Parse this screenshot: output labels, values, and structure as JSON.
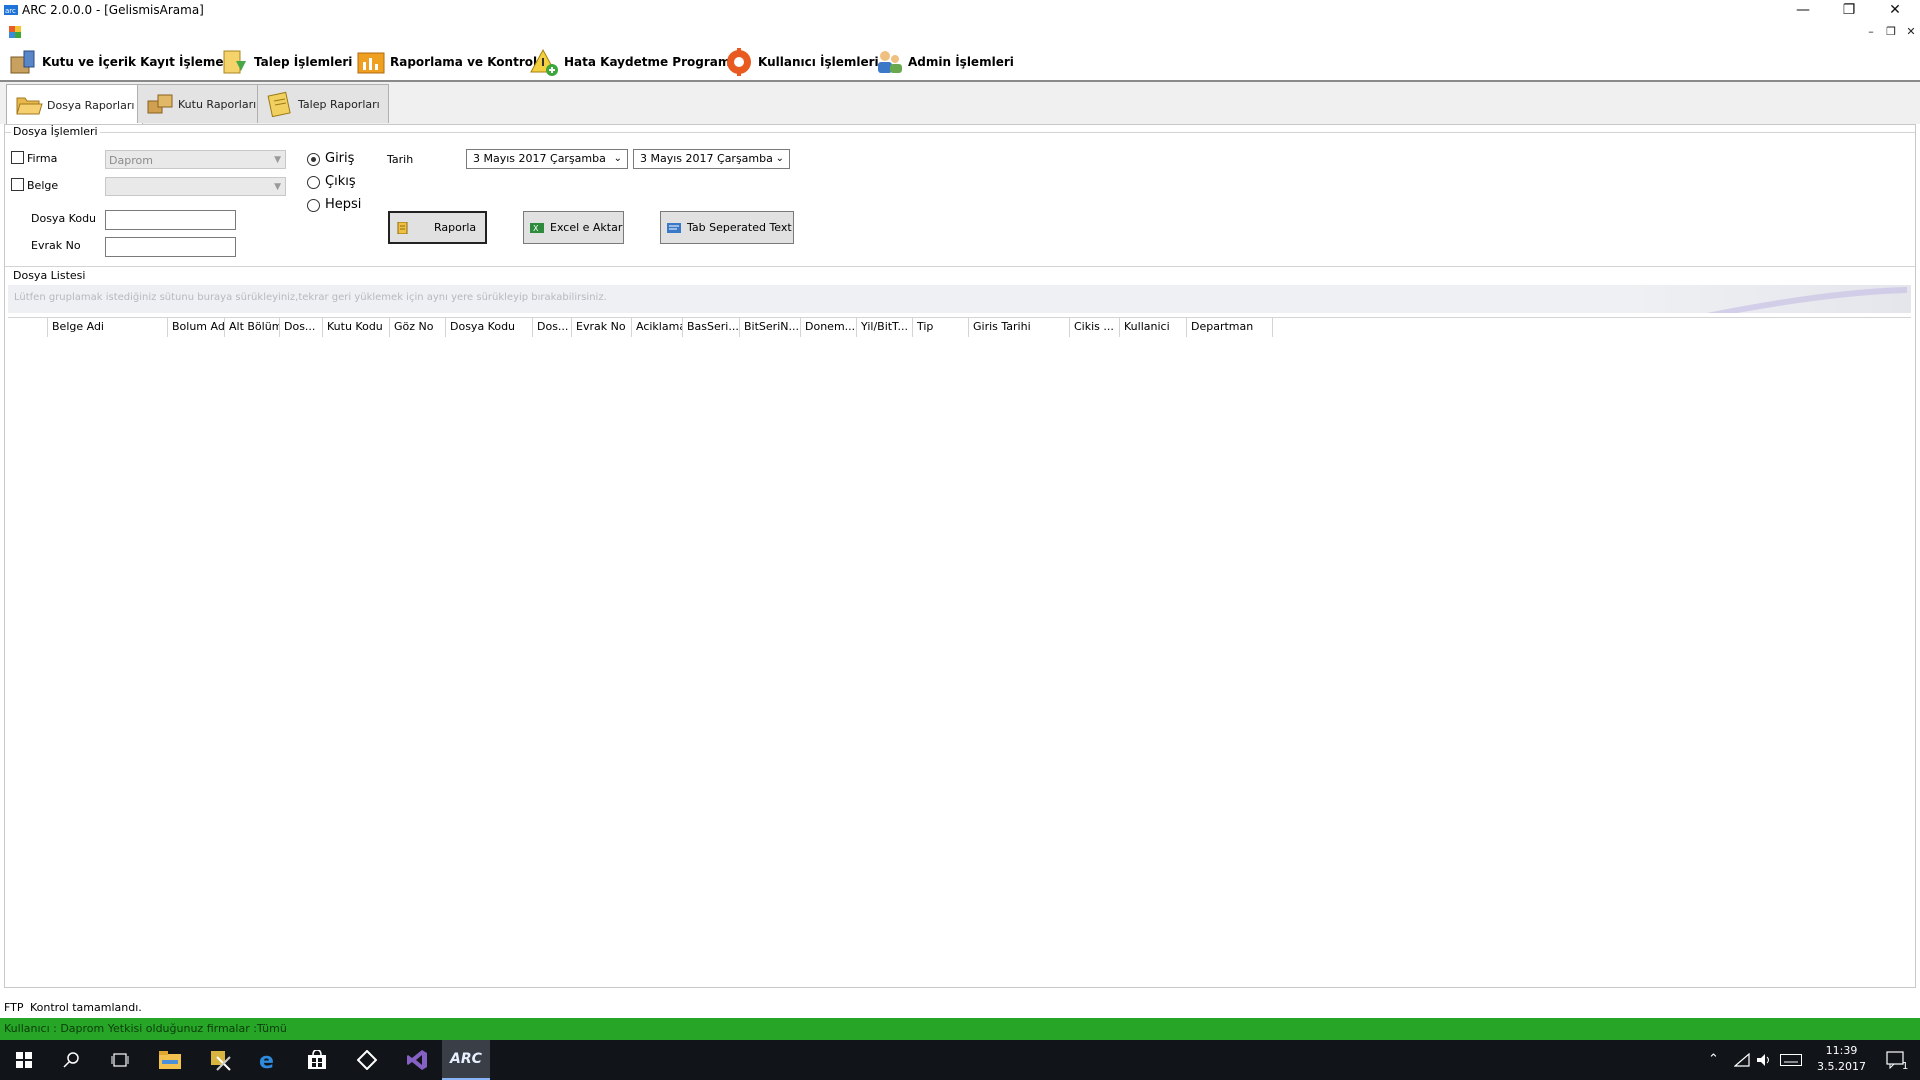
{
  "window": {
    "title": "ARC 2.0.0.0 - [GelismisArama]"
  },
  "menu": [
    {
      "label": "Kutu ve İçerik Kayıt İşlemeri",
      "icon": "box-register-icon"
    },
    {
      "label": "Talep İşlemleri",
      "icon": "request-icon"
    },
    {
      "label": "Raporlama ve Kontrol",
      "icon": "report-chart-icon"
    },
    {
      "label": "Hata Kaydetme Programı",
      "icon": "warning-add-icon"
    },
    {
      "label": "Kullanıcı İşlemleri",
      "icon": "user-gear-icon"
    },
    {
      "label": "Admin İşlemleri",
      "icon": "admin-users-icon"
    }
  ],
  "tabs": [
    {
      "label": "Dosya Raporları",
      "active": true
    },
    {
      "label": "Kutu Raporları",
      "active": false
    },
    {
      "label": "Talep Raporları",
      "active": false
    }
  ],
  "filters": {
    "group_title": "Dosya İşlemleri",
    "firma_label": "Firma",
    "firma_value": "Daprom",
    "belge_label": "Belge",
    "belge_value": "",
    "dosya_kodu_label": "Dosya Kodu",
    "evrak_no_label": "Evrak No",
    "radios": [
      {
        "label": "Giriş",
        "checked": true
      },
      {
        "label": "Çıkış",
        "checked": false
      },
      {
        "label": "Hepsi",
        "checked": false
      }
    ],
    "tarih_label": "Tarih",
    "date_from": "3  Mayıs   2017 Çarşamba",
    "date_to": "3  Mayıs   2017 Çarşamba"
  },
  "buttons": {
    "raporla": "Raporla",
    "excel": "Excel e Aktar",
    "tab": "Tab Seperated Text"
  },
  "grid": {
    "title": "Dosya Listesi",
    "group_hint": "Lütfen gruplamak istediğiniz sütunu buraya sürükleyiniz,tekrar geri yüklemek için aynı yere sürükleyip bırakabilirsiniz.",
    "columns": [
      "",
      "Belge Adi",
      "Bolum Adi",
      "Alt Bölüm",
      "Dos...",
      "Kutu Kodu",
      "Göz No",
      "Dosya Kodu",
      "Dos...",
      "Evrak No",
      "Aciklama",
      "BasSeri...",
      "BitSeriN...",
      "Donem...",
      "Yil/BitT...",
      "Tip",
      "Giris Tarihi",
      "Cikis ...",
      "Kullanici",
      "Departman"
    ]
  },
  "status": {
    "ftp_label": "FTP",
    "ftp_message": "Kontrol tamamlandı.",
    "user_line": "Kullanıcı : Daprom   Yetkisi olduğunuz firmalar :Tümü"
  },
  "taskbar": {
    "apps": [
      "start-icon",
      "search-icon",
      "task-view-icon",
      "file-explorer-icon",
      "tools-icon",
      "edge-icon",
      "store-icon",
      "code-icon",
      "visual-studio-icon",
      "arc-app-icon"
    ],
    "arc_label": "ARC",
    "time": "11:39",
    "date": "3.5.2017",
    "notif_count": "1"
  },
  "colors": {
    "status_green": "#26a526",
    "taskbar": "#111418",
    "menu_icon_orange": "#f0a020"
  }
}
